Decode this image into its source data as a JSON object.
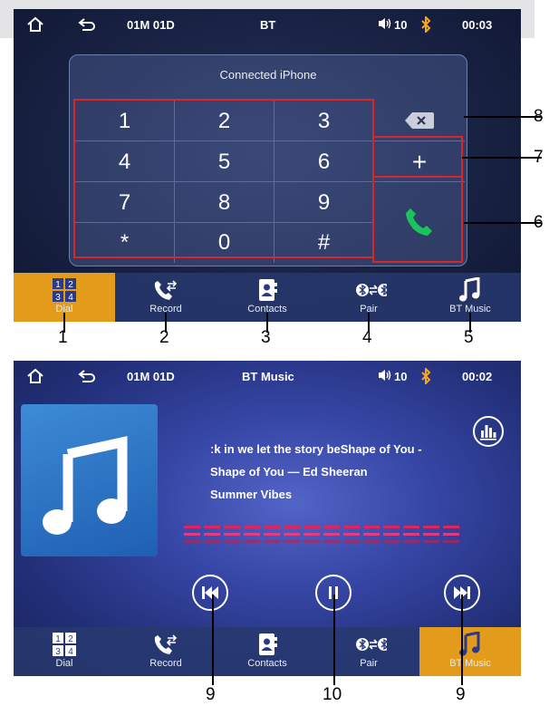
{
  "colors": {
    "accent": "#e39b1b",
    "bluetooth": "#f5a623",
    "callout": "#d9262b",
    "call_green": "#19c45a"
  },
  "dial_screen": {
    "status": {
      "home_icon": "home-icon",
      "back_icon": "back-icon",
      "source": "01M 01D",
      "title": "BT",
      "volume": "10",
      "bluetooth_icon": "bluetooth-icon",
      "time": "00:03"
    },
    "keypad": {
      "title": "Connected iPhone",
      "keys": [
        "1",
        "2",
        "3",
        "4",
        "5",
        "6",
        "7",
        "8",
        "9",
        "*",
        "0",
        "#"
      ],
      "backspace_icon": "backspace-icon",
      "plus": "+",
      "call_icon": "phone-call-icon"
    }
  },
  "music_screen": {
    "status": {
      "source": "01M 01D",
      "title": "BT Music",
      "volume": "10",
      "time": "00:02"
    },
    "lyric": "ːk in we let the story beShape of You -",
    "track": "Shape of You — Ed Sheeran",
    "album": "Summer Vibes",
    "controls": {
      "prev_icon": "previous-track-icon",
      "pause_icon": "pause-icon",
      "next_icon": "next-track-icon",
      "eq_icon": "equalizer-icon"
    }
  },
  "tabs": [
    {
      "label": "Dial",
      "icon": "dialpad-icon"
    },
    {
      "label": "Record",
      "icon": "call-record-icon"
    },
    {
      "label": "Contacts",
      "icon": "contacts-icon"
    },
    {
      "label": "Pair",
      "icon": "bluetooth-pair-icon"
    },
    {
      "label": "BT Music",
      "icon": "music-note-icon"
    }
  ],
  "callouts": {
    "side": [
      "8",
      "7",
      "6"
    ],
    "tabs": [
      "1",
      "2",
      "3",
      "4",
      "5"
    ],
    "controls": [
      "9",
      "10",
      "9"
    ]
  }
}
